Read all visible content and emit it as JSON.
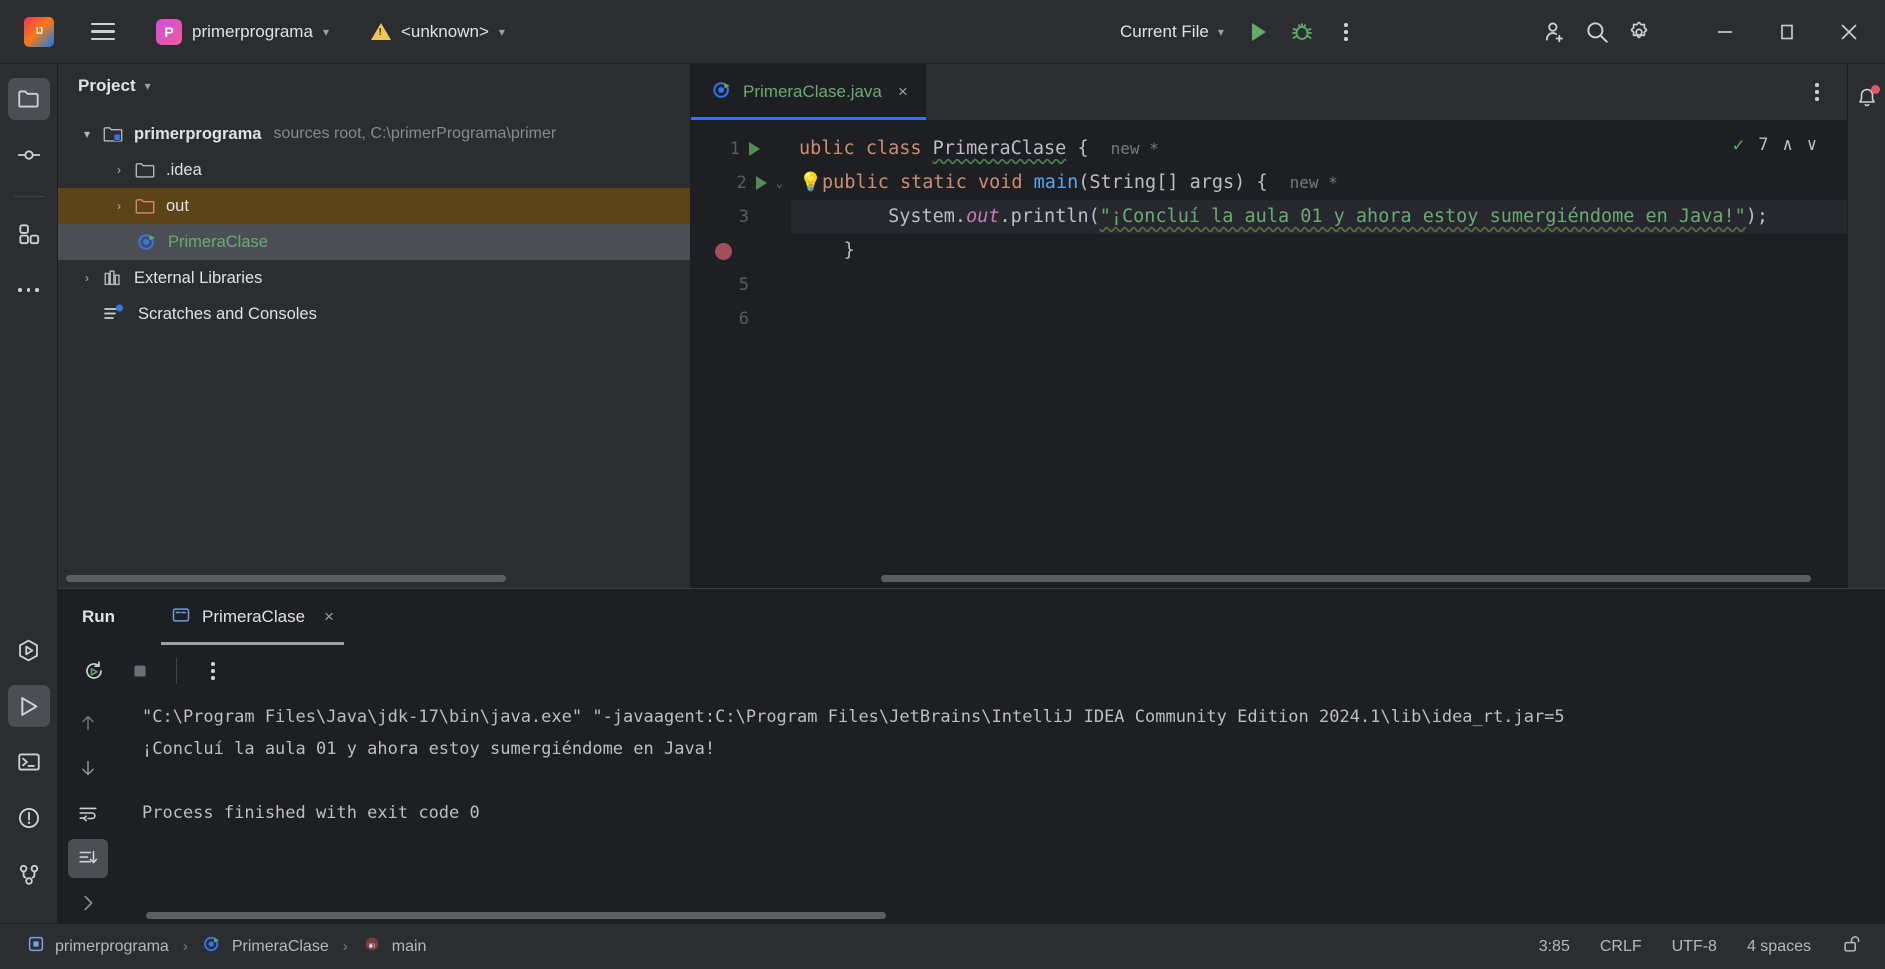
{
  "titlebar": {
    "logo_alt": "IJ",
    "menu_icon": "hamburger-icon",
    "project_badge": "P",
    "project_name": "primerprograma",
    "run_config_name": "<unknown>",
    "current_file_label": "Current File",
    "run_icon": "run-icon",
    "debug_icon": "debug-icon",
    "more_icon": "more-actions-icon",
    "account_icon": "add-account-icon",
    "search_icon": "search-icon",
    "settings_icon": "settings-gear-icon",
    "minimize_icon": "minimize-icon",
    "maximize_icon": "maximize-icon",
    "close_icon": "close-icon"
  },
  "rail": {
    "top": [
      {
        "name": "project-tool-icon",
        "label": "Project"
      },
      {
        "name": "commit-tool-icon",
        "label": "Commit"
      },
      {
        "name": "plugins-tool-icon",
        "label": "Plugins"
      },
      {
        "name": "more-tool-icon",
        "label": "More Tool Windows"
      }
    ],
    "bottom": [
      {
        "name": "run-anything-icon",
        "label": "Run Anything"
      },
      {
        "name": "run-tool-icon",
        "label": "Run"
      },
      {
        "name": "terminal-tool-icon",
        "label": "Terminal"
      },
      {
        "name": "problems-tool-icon",
        "label": "Problems"
      },
      {
        "name": "version-control-tool-icon",
        "label": "Version Control"
      }
    ]
  },
  "project_panel": {
    "title": "Project",
    "tree": [
      {
        "label": "primerprograma",
        "meta": "sources root,  C:\\primerPrograma\\primer",
        "icon": "module-folder-icon",
        "arrow": "⌄",
        "indent": 0,
        "state": "normal",
        "bold": true
      },
      {
        "label": ".idea",
        "meta": "",
        "icon": "folder-icon",
        "arrow": "›",
        "indent": 1,
        "state": "normal",
        "bold": false
      },
      {
        "label": "out",
        "meta": "",
        "icon": "excluded-folder-icon",
        "arrow": "›",
        "indent": 1,
        "state": "highlight",
        "bold": false
      },
      {
        "label": "PrimeraClase",
        "meta": "",
        "icon": "java-class-runnable-icon",
        "arrow": "",
        "indent": 2,
        "state": "selected",
        "bold": false
      },
      {
        "label": "External Libraries",
        "meta": "",
        "icon": "libraries-icon",
        "arrow": "›",
        "indent": 0,
        "state": "normal",
        "bold": false
      },
      {
        "label": "Scratches and Consoles",
        "meta": "",
        "icon": "scratches-icon",
        "arrow": "",
        "indent": 0,
        "state": "normal",
        "bold": false
      }
    ]
  },
  "editor": {
    "tab": {
      "label": "PrimeraClase.java",
      "icon": "java-class-runnable-icon",
      "close": "×"
    },
    "options_icon": "editor-options-icon",
    "inspection": {
      "icon": "inspections-ok-icon",
      "count": "7",
      "up": "∧",
      "down": "∨"
    },
    "gutter": [
      {
        "number": "1",
        "marker": "run-gutter-icon",
        "fold": ""
      },
      {
        "number": "2",
        "marker": "run-gutter-icon",
        "fold": "⌄"
      },
      {
        "number": "3",
        "marker": "",
        "fold": ""
      },
      {
        "number": "",
        "marker": "breakpoint-icon",
        "fold": ""
      },
      {
        "number": "5",
        "marker": "",
        "fold": ""
      },
      {
        "number": "6",
        "marker": "",
        "fold": ""
      }
    ],
    "code": {
      "line1": {
        "kw": "ublic class ",
        "cls": "PrimeraClase",
        "tail": " {",
        "hint": "new *"
      },
      "line2": {
        "kw": "public static void ",
        "mth": "main",
        "args": "(String[] args) {",
        "hint": "new *"
      },
      "line3": {
        "obj": "System.",
        "fld": "out",
        "call": ".println(",
        "str": "\"¡Concluí la aula 01 y ahora estoy sumergiéndome en Java!\"",
        "end": ");"
      },
      "line4": "}"
    }
  },
  "run_window": {
    "label": "Run",
    "tab": {
      "label": "PrimeraClase",
      "icon": "console-icon",
      "close": "×"
    },
    "toolbar": [
      {
        "name": "rerun-button",
        "icon": "rerun-icon"
      },
      {
        "name": "stop-button",
        "icon": "stop-icon"
      },
      {
        "name": "run-more-button",
        "icon": "more-actions-icon"
      }
    ],
    "console_rail": [
      {
        "name": "previous-occurrence-button",
        "icon": "arrow-up-icon",
        "active": false
      },
      {
        "name": "next-occurrence-button",
        "icon": "arrow-down-icon",
        "active": false
      },
      {
        "name": "soft-wrap-button",
        "icon": "soft-wrap-icon",
        "active": false
      },
      {
        "name": "scroll-to-end-button",
        "icon": "scroll-to-end-icon",
        "active": true
      },
      {
        "name": "expand-button",
        "icon": "chevron-right-icon",
        "active": false
      }
    ],
    "output": [
      "\"C:\\Program Files\\Java\\jdk-17\\bin\\java.exe\" \"-javaagent:C:\\Program Files\\JetBrains\\IntelliJ IDEA Community Edition 2024.1\\lib\\idea_rt.jar=5",
      "¡Concluí la aula 01 y ahora estoy sumergiéndome en Java!",
      "",
      "Process finished with exit code 0"
    ]
  },
  "statusbar": {
    "breadcrumbs": [
      {
        "label": "primerprograma",
        "icon": "module-icon"
      },
      {
        "label": "PrimeraClase",
        "icon": "java-class-runnable-icon"
      },
      {
        "label": "main",
        "icon": "method-icon"
      }
    ],
    "separator": "›",
    "caret": "3:85",
    "line_separator": "CRLF",
    "encoding": "UTF-8",
    "indent": "4 spaces",
    "lock_icon": "unlocked-icon"
  },
  "notifications": {
    "bell_icon": "notifications-bell-icon"
  },
  "colors": {
    "accent_blue": "#3574f0",
    "string_green": "#6aab73",
    "keyword_orange": "#cf8e6d",
    "method_blue": "#56a8f5",
    "field_purple": "#c77dbb",
    "warn_yellow": "#f2c55c",
    "error_red": "#e55765",
    "panel_bg": "#2b2d30",
    "editor_bg": "#1e1f22"
  }
}
